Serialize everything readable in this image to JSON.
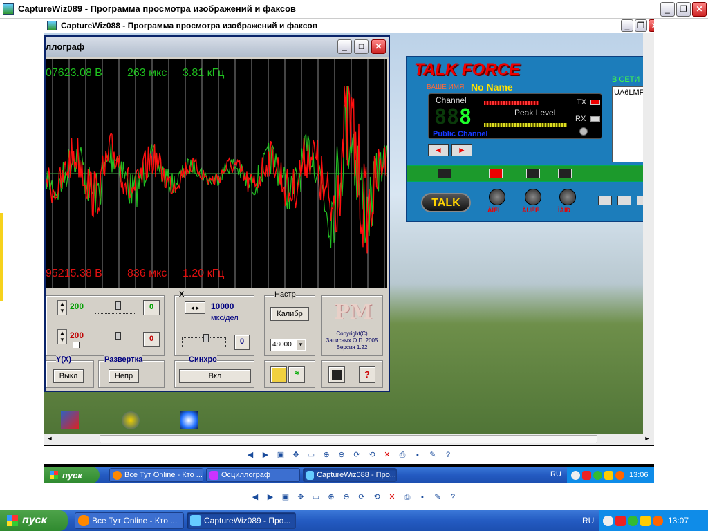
{
  "outer_window": {
    "title": "CaptureWiz089 - Программа просмотра изображений и факсов",
    "minimize": "_",
    "maximize": "❐",
    "close": "✕"
  },
  "inner_window": {
    "title": "CaptureWiz088 - Программа просмотра изображений и факсов",
    "minimize": "_",
    "maximize": "❐",
    "close": "✕"
  },
  "oscilloscope": {
    "title": "ллограф",
    "readouts": {
      "top_voltage": "07623.08 В",
      "top_time": "263 мкс",
      "top_freq": "3.81 кГц",
      "bottom_voltage": "95215.38 В",
      "bottom_time": "836 мкс",
      "bottom_freq": "1.20 кГц"
    },
    "ch1_value": "200",
    "ch1_offset": "0",
    "ch2_value": "200",
    "ch2_offset": "0",
    "x_label": "X",
    "timebase_value": "10000",
    "timebase_unit": "мкс/дел",
    "x_offset": "0",
    "settings_label": "Настр",
    "calibrate_button": "Калибр",
    "sample_rate": "48000",
    "logo": "PM",
    "copyright_line1": "Copyright(C)",
    "copyright_line2": "Записных О.П. 2005",
    "copyright_line3": "Версия 1.22",
    "yx_label": "Y(X)",
    "yx_button": "Выкл",
    "sweep_label": "Развертка",
    "sweep_button": "Непр",
    "sync_label": "Синхро",
    "sync_button": "Вкл",
    "help_button": "?"
  },
  "talkforce": {
    "logo": "TALK FORCE",
    "your_name_label": "ВАШЕ ИМЯ",
    "your_name_value": "No Name",
    "channel_label": "Channel",
    "channel_digits": "8",
    "channel_name": "Public Channel",
    "peak_label": "Peak Level",
    "tx_label": "TX",
    "rx_label": "RX",
    "online_label": "В СЕТИ",
    "online_user": "UA6LMF",
    "talk_button": "TALK",
    "knob1_label": "ÀÍÊÍ",
    "knob2_label": "ÀÜÊÊ",
    "knob3_label": "ÌÀÍÐ"
  },
  "inner_taskbar": {
    "start": "пуск",
    "tasks": [
      {
        "label": "Все Тут Online - Кто ..."
      },
      {
        "label": "Осциллограф"
      },
      {
        "label": "CaptureWiz088 - Про..."
      }
    ],
    "lang": "RU",
    "clock": "13:06"
  },
  "outer_taskbar": {
    "start": "пуск",
    "tasks": [
      {
        "label": "Все Тут Online - Кто ..."
      },
      {
        "label": "CaptureWiz089 - Про..."
      }
    ],
    "lang": "RU",
    "clock": "13:07"
  },
  "toolbar_icons": [
    "prev-icon",
    "next-icon",
    "best-fit-icon",
    "actual-size-icon",
    "slideshow-icon",
    "zoom-in-icon",
    "zoom-out-icon",
    "rotate-cw-icon",
    "rotate-ccw-icon",
    "delete-icon",
    "print-icon",
    "save-icon",
    "edit-icon",
    "help-icon"
  ],
  "colors": {
    "accent_green": "#00c000",
    "trace_red": "#ff1010",
    "tf_blue": "#1c7dbb",
    "taskbar_blue": "#245bc2"
  }
}
